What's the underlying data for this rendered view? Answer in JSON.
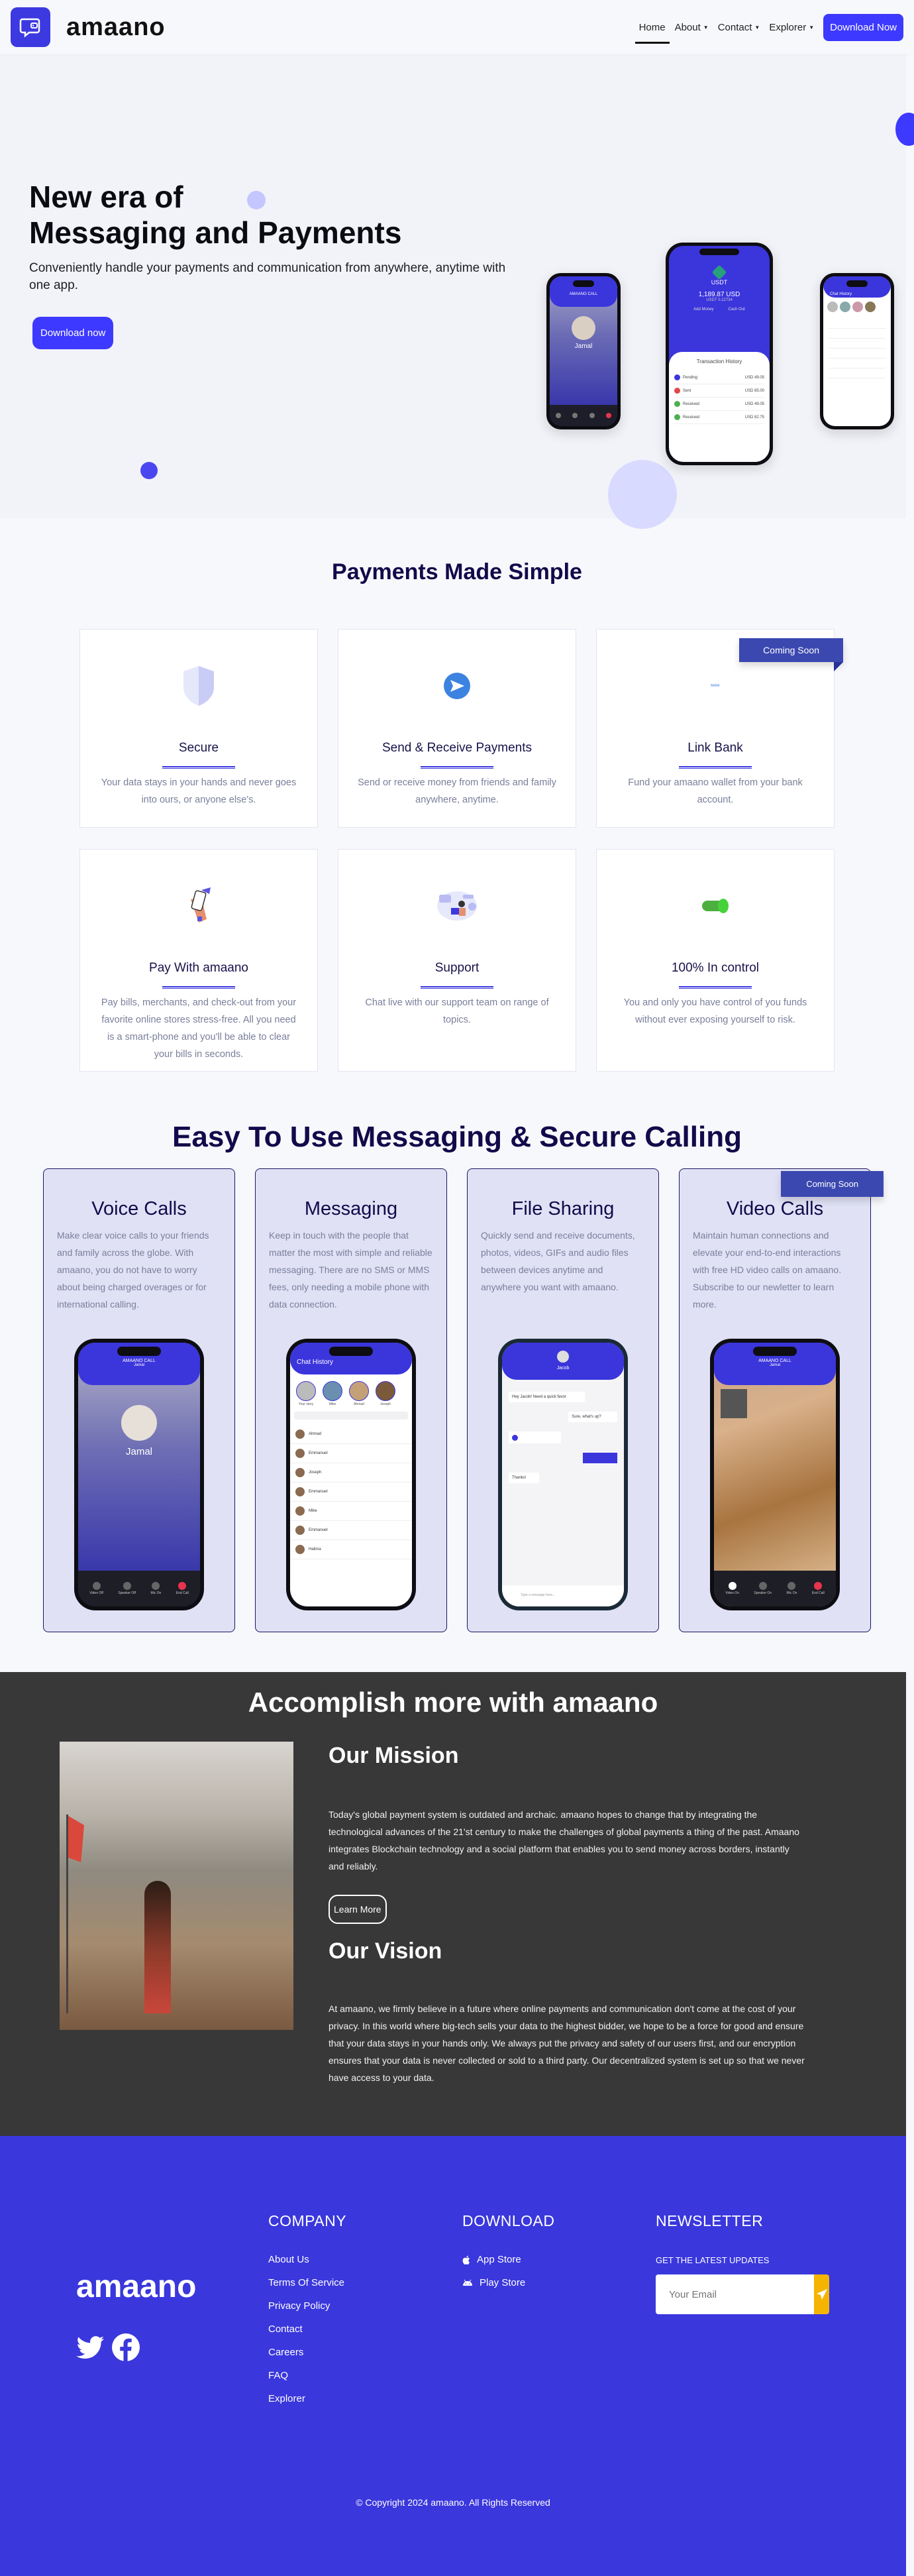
{
  "nav": {
    "brand": "amaano",
    "links": [
      {
        "label": "Home",
        "active": true,
        "dropdown": false
      },
      {
        "label": "About",
        "active": false,
        "dropdown": true
      },
      {
        "label": "Contact",
        "active": false,
        "dropdown": true
      },
      {
        "label": "Explorer",
        "active": false,
        "dropdown": true
      }
    ],
    "download_label": "Download Now"
  },
  "hero": {
    "title_line1": "New era of",
    "title_line2": "Messaging and Payments",
    "subtitle": "Conveniently handle your payments and communication from anywhere, anytime with one app.",
    "cta": "Download now",
    "phones": {
      "call": {
        "title": "AMAANO CALL",
        "name": "Jamal"
      },
      "wallet": {
        "coin": "USDT",
        "balance": "1,189.87 USD",
        "sub": "USDT 0.12734",
        "actions": [
          "Add Money",
          "Cash Out"
        ],
        "history_title": "Transaction History",
        "transactions": [
          {
            "type": "Pending",
            "amount": "USD 49.05"
          },
          {
            "type": "Sent",
            "amount": "USD 85.00"
          },
          {
            "type": "Received",
            "amount": "USD 49.05"
          },
          {
            "type": "Received",
            "amount": "USD 82.75"
          }
        ]
      },
      "chat": {
        "title": "Chat History"
      }
    }
  },
  "payments": {
    "title": "Payments Made Simple",
    "cards": [
      {
        "icon": "shield-icon",
        "title": "Secure",
        "desc": "Your data stays in your hands and never goes into ours, or anyone else's.",
        "badge": ""
      },
      {
        "icon": "send-icon",
        "title": "Send & Receive Payments",
        "desc": "Send or receive money from friends and family anywhere, anytime.",
        "badge": ""
      },
      {
        "icon": "bank-icon",
        "title": "Link Bank",
        "desc": "Fund your amaano wallet from your bank account.",
        "badge": "Coming Soon",
        "icon_text": "BANK"
      },
      {
        "icon": "pay-phone-icon",
        "title": "Pay With amaano",
        "desc": "Pay bills, merchants, and check-out from your favorite online stores stress-free. All you need is a smart-phone and you'll be able to clear your bills in seconds.",
        "badge": ""
      },
      {
        "icon": "support-icon",
        "title": "Support",
        "desc": "Chat live with our support team on range of topics.",
        "badge": ""
      },
      {
        "icon": "toggle-icon",
        "title": "100% In control",
        "desc": "You and only you have control of you funds without ever exposing yourself to risk.",
        "badge": ""
      }
    ]
  },
  "messaging": {
    "title": "Easy To Use Messaging & Secure Calling",
    "cards": [
      {
        "title": "Voice Calls",
        "desc": "Make clear voice calls to your friends and family across the globe. With amaano, you do not have to worry about being charged overages or for international calling.",
        "badge": "",
        "phone": {
          "header": "AMAANO CALL",
          "name": "Jamal",
          "controls": [
            "Video Off",
            "Speaker Off",
            "Mic On",
            "End Call"
          ]
        }
      },
      {
        "title": "Messaging",
        "desc": "Keep in touch with the people that matter the most with simple and reliable messaging. There are no SMS or MMS fees, only needing a mobile phone with data connection.",
        "badge": "",
        "phone": {
          "header": "Chat History",
          "stories": [
            "Your story",
            "Mike",
            "Ahmad",
            "Joseph"
          ],
          "chats": [
            "Ahmad",
            "Emmanuel",
            "Joseph",
            "Emmanuel",
            "Mike",
            "Emmanuel",
            "Halima"
          ]
        }
      },
      {
        "title": "File Sharing",
        "desc": "Quickly send and receive documents, photos, videos, GIFs and audio files between devices anytime and anywhere you want with amaano.",
        "badge": "",
        "phone": {
          "contact": "Jacob",
          "messages": [
            "Hey Jacob! Need a quick favor",
            "Sure, what's up?",
            "Thanks!"
          ],
          "input_placeholder": "Type a message here..."
        }
      },
      {
        "title": "Video Calls",
        "desc": "Maintain human connections and elevate your end-to-end interactions with free HD video calls on amaano. Subscribe to our newletter to learn more.",
        "badge": "Coming Soon",
        "phone": {
          "header": "AMAANO CALL",
          "name": "Jamal",
          "controls": [
            "Video On",
            "Speaker On",
            "Mic On",
            "End Call"
          ]
        }
      }
    ]
  },
  "about": {
    "title": "Accomplish more with amaano",
    "mission_title": "Our Mission",
    "mission_text": "Today's global payment system is outdated and archaic. amaano hopes to change that by integrating the technological advances of the 21'st century to make the challenges of global payments a thing of the past. Amaano integrates Blockchain technology and a social platform that enables you to send money across borders, instantly and reliably.",
    "learn_more": "Learn More",
    "vision_title": "Our Vision",
    "vision_text": "At amaano, we firmly believe in a future where online payments and communication don't come at the cost of your privacy. In this world where big-tech sells your data to the highest bidder, we hope to be a force for good and ensure that your data stays in your hands only. We always put the privacy and safety of our users first, and our encryption ensures that your data is never collected or sold to a third party. Our decentralized system is set up so that we never have access to your data."
  },
  "footer": {
    "brand": "amaano",
    "company_title": "COMPANY",
    "company_links": [
      "About Us",
      "Terms Of Service",
      "Privacy Policy",
      "Contact",
      "Careers",
      "FAQ",
      "Explorer"
    ],
    "download_title": "DOWNLOAD",
    "download_links": [
      {
        "label": "App Store",
        "icon": "apple-icon"
      },
      {
        "label": "Play Store",
        "icon": "android-icon"
      }
    ],
    "newsletter_title": "NEWSLETTER",
    "newsletter_sub": "GET THE LATEST UPDATES",
    "email_placeholder": "Your Email",
    "copyright": "© Copyright 2024 amaano. All Rights Reserved"
  },
  "colors": {
    "brand": "#3d39e0",
    "accent": "#3d39ff",
    "dark": "#383838",
    "footer": "#3a37dd",
    "ribbon": "#3b48b0",
    "send": "#f5b400"
  }
}
